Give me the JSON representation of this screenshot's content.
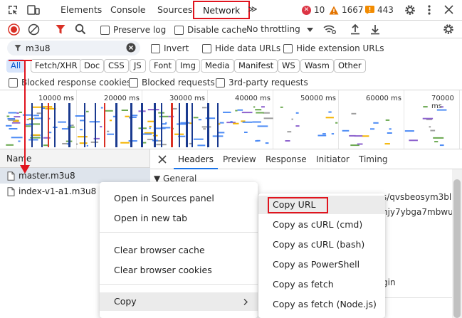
{
  "tabs": {
    "elements": "Elements",
    "console": "Console",
    "sources": "Sources",
    "network": "Network",
    "more": "≫"
  },
  "counters": {
    "errors": "10",
    "warnings": "1667",
    "issues": "443"
  },
  "toolbar": {
    "preserve_log": "Preserve log",
    "disable_cache": "Disable cache",
    "throttling": "No throttling"
  },
  "filter": {
    "value": "m3u8",
    "invert": "Invert",
    "hide_data_urls": "Hide data URLs",
    "hide_extension_urls": "Hide extension URLs"
  },
  "types": [
    "All",
    "Fetch/XHR",
    "Doc",
    "CSS",
    "JS",
    "Font",
    "Img",
    "Media",
    "Manifest",
    "WS",
    "Wasm",
    "Other"
  ],
  "blocked": {
    "cookies": "Blocked response cookies",
    "requests": "Blocked requests",
    "third_party": "3rd-party requests"
  },
  "timeline": {
    "ticks": [
      "10000 ms",
      "20000 ms",
      "30000 ms",
      "40000 ms",
      "50000 ms",
      "60000 ms",
      "70000 ms"
    ]
  },
  "list": {
    "header": "Name",
    "requests": [
      "master.m3u8",
      "index-v1-a1.m3u8"
    ]
  },
  "details": {
    "tabs": [
      "Headers",
      "Preview",
      "Response",
      "Initiator",
      "Timing"
    ],
    "general": "▼ General",
    "partial1": "s/qvsbeosym3bl",
    "partial2": "njy7ybga7mbwu",
    "partial3": "gin"
  },
  "context_menu": {
    "items": [
      "Open in Sources panel",
      "Open in new tab",
      "Clear browser cache",
      "Clear browser cookies",
      "Copy"
    ]
  },
  "copy_menu": {
    "items": [
      "Copy URL",
      "Copy as cURL (cmd)",
      "Copy as cURL (bash)",
      "Copy as PowerShell",
      "Copy as fetch",
      "Copy as fetch (Node.js)"
    ]
  },
  "colors": {
    "accent": "#1a73e8",
    "annotation": "#e0141e",
    "error": "#dc3545",
    "warning": "#e37400",
    "issue": "#f28b00"
  }
}
